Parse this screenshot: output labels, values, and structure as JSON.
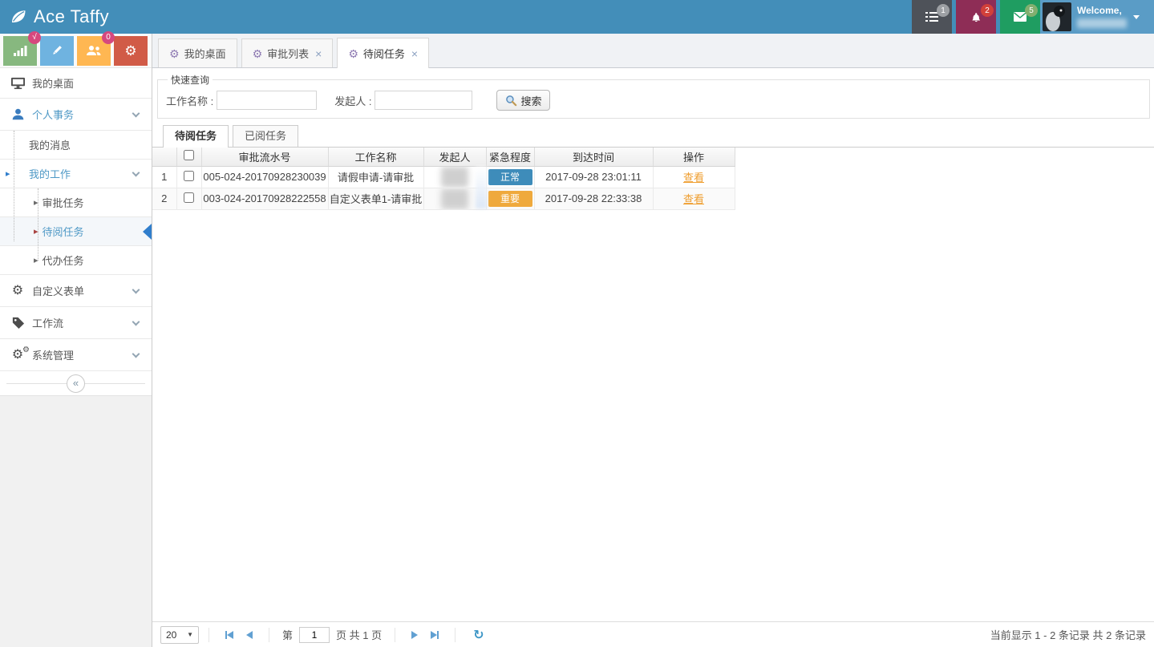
{
  "app": {
    "title": "Ace Taffy"
  },
  "colors": {
    "navbar": "#438eb9",
    "user_panel": "#5a9cc6",
    "btn_gray": "#4e5259",
    "btn_berry": "#8e2d56",
    "btn_green": "#1f9d61",
    "shortcut_green": "#87b87f",
    "shortcut_blue": "#6fb3e0",
    "shortcut_orange": "#ffb752",
    "shortcut_red": "#d15b47",
    "accent_blue": "#4f99c6",
    "urgency_normal": "#3e8cba",
    "urgency_important": "#efa93c",
    "link_orange": "#ef9e2f"
  },
  "icons": {
    "gear": "⚙",
    "close": "×",
    "caret": "▼",
    "arrow": "▸",
    "collapse": "«",
    "refresh": "↻"
  },
  "navbar": {
    "badges": {
      "tasks": "1",
      "alerts": "2",
      "mail": "5"
    },
    "welcome": "Welcome,"
  },
  "sidebar": {
    "shortcut_badges": {
      "stats": "√",
      "users": "0"
    },
    "items": [
      {
        "label": "我的桌面"
      },
      {
        "label": "个人事务",
        "children": [
          {
            "label": "我的消息"
          },
          {
            "label": "我的工作",
            "children": [
              {
                "label": "审批任务"
              },
              {
                "label": "待阅任务"
              },
              {
                "label": "代办任务"
              }
            ]
          }
        ]
      },
      {
        "label": "自定义表单"
      },
      {
        "label": "工作流"
      },
      {
        "label": "系统管理"
      }
    ]
  },
  "tabs": [
    {
      "label": "我的桌面"
    },
    {
      "label": "审批列表"
    },
    {
      "label": "待阅任务"
    }
  ],
  "search": {
    "legend": "快速查询",
    "name_label": "工作名称 :",
    "initiator_label": "发起人 :",
    "button": "搜索"
  },
  "subtabs": [
    {
      "label": "待阅任务"
    },
    {
      "label": "已阅任务"
    }
  ],
  "grid": {
    "columns": [
      "审批流水号",
      "工作名称",
      "发起人",
      "紧急程度",
      "到达时间",
      "操作"
    ],
    "rows": [
      {
        "num": "1",
        "id": "005-024-20170928230039",
        "name": "请假申请-请审批",
        "urgency": "正常",
        "badge_style": "background-color:#3e8cba",
        "time": "2017-09-28 23:01:11",
        "action": "查看"
      },
      {
        "num": "2",
        "id": "003-024-20170928222558",
        "name": "自定义表单1-请审批",
        "urgency": "重要",
        "badge_style": "background-color:#efa93c",
        "time": "2017-09-28 22:33:38",
        "action": "查看"
      }
    ]
  },
  "pagination": {
    "page_size": "20",
    "prefix": "第",
    "page_value": "1",
    "suffix": "页 共 1 页",
    "info": "当前显示 1 - 2 条记录 共 2 条记录"
  }
}
